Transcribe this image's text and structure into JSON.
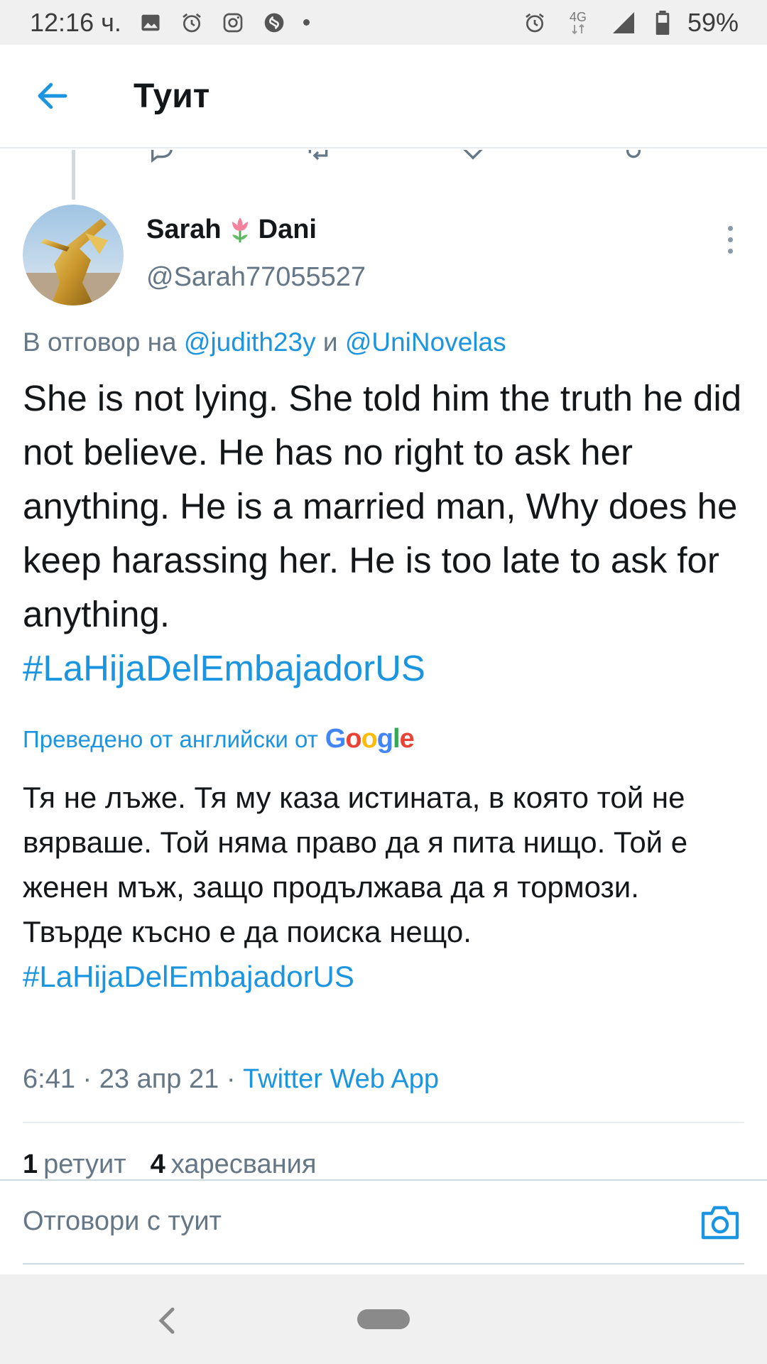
{
  "status_bar": {
    "time": "12:16 ч.",
    "network": "4G",
    "battery": "59%"
  },
  "app_bar": {
    "title": "Туит"
  },
  "tweet": {
    "display_name_1": "Sarah",
    "display_name_2": "Dani",
    "handle": "@Sarah77055527",
    "reply_prefix": "В отговор на ",
    "reply_user_1": "@judith23y",
    "reply_conj": " и ",
    "reply_user_2": "@UniNovelas",
    "text": "She is not lying. She told him the truth he did not believe. He has no right to ask her anything. He is a married man, Why does he keep harassing her. He is too late to ask for anything.",
    "hashtag": "#LaHijaDelEmbajadorUS",
    "translated_label": "Преведено от английски от",
    "google_logo": "Google",
    "translation_text": "Тя не лъже. Тя му каза истината, в която той не вярваше. Той няма право да я пита нищо. Той е женен мъж, защо продължава да я тормози. Твърде късно е да поиска нещо.",
    "translation_hashtag": "#LaHijaDelEmbajadorUS",
    "time": "6:41",
    "date": "23 апр 21",
    "source": "Twitter Web App",
    "retweets_count": "1",
    "retweets_label": "ретуит",
    "likes_count": "4",
    "likes_label": "харесвания"
  },
  "reply_bar": {
    "placeholder": "Отговори с туит"
  },
  "colors": {
    "accent": "#1b95e0",
    "text": "#14171a",
    "muted": "#657786"
  }
}
